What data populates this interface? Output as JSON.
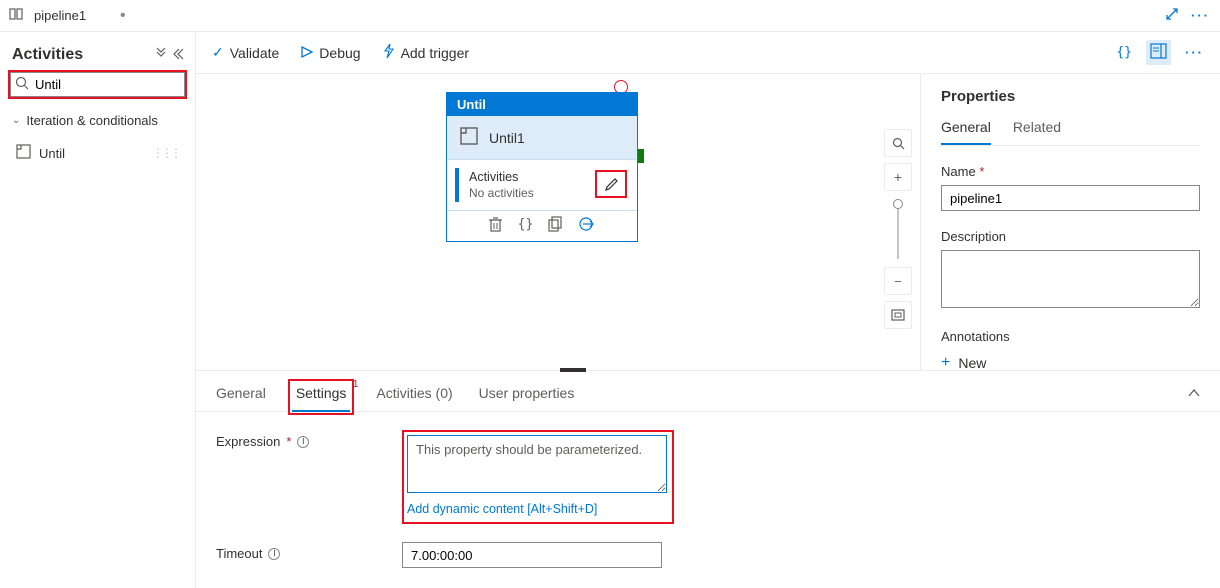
{
  "titlebar": {
    "pipeline_name": "pipeline1"
  },
  "sidebar": {
    "title": "Activities",
    "search_value": "Until",
    "group_label": "Iteration & conditionals",
    "item_label": "Until"
  },
  "toolbar": {
    "validate": "Validate",
    "debug": "Debug",
    "add_trigger": "Add trigger"
  },
  "node": {
    "type_label": "Until",
    "name": "Until1",
    "activities_label": "Activities",
    "activities_status": "No activities"
  },
  "properties": {
    "title": "Properties",
    "tab_general": "General",
    "tab_related": "Related",
    "name_label": "Name",
    "name_value": "pipeline1",
    "description_label": "Description",
    "description_value": "",
    "annotations_label": "Annotations",
    "new_label": "New"
  },
  "detail": {
    "tab_general": "General",
    "tab_settings": "Settings",
    "tab_settings_badge": "1",
    "tab_activities": "Activities (0)",
    "tab_userprops": "User properties",
    "expression_label": "Expression",
    "expression_placeholder": "This property should be parameterized.",
    "dynamic_link": "Add dynamic content [Alt+Shift+D]",
    "timeout_label": "Timeout",
    "timeout_value": "7.00:00:00"
  }
}
